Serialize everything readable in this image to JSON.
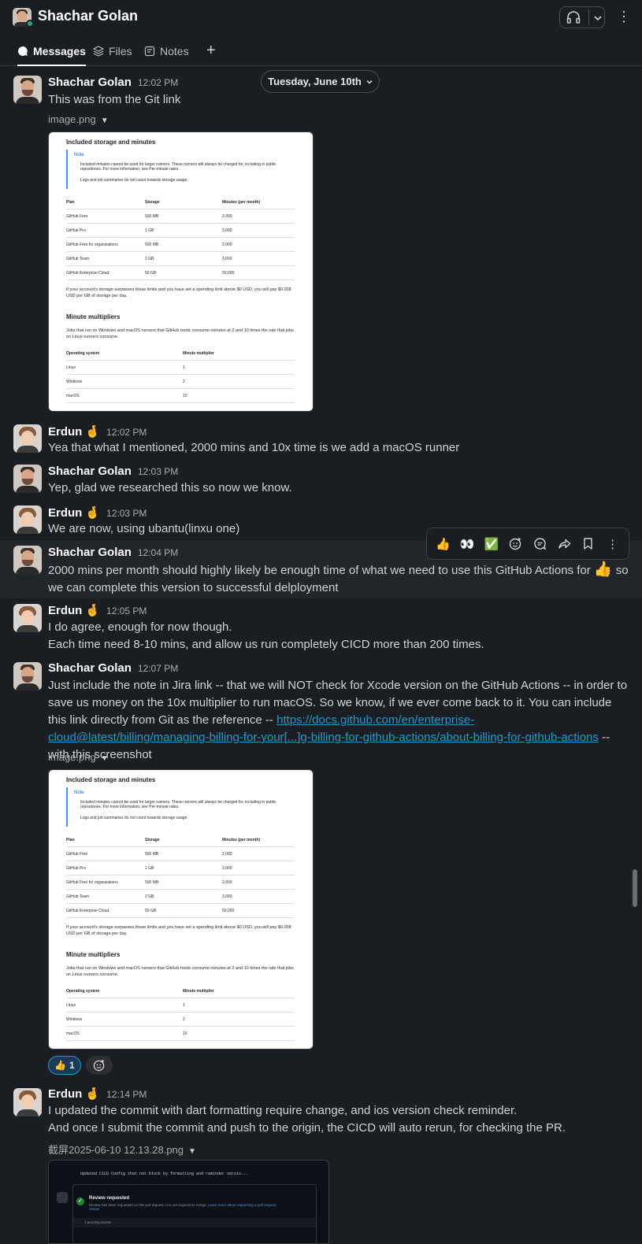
{
  "header": {
    "title": "Shachar Golan",
    "tabs": [
      {
        "label": "Messages"
      },
      {
        "label": "Files"
      },
      {
        "label": "Notes"
      }
    ],
    "add_tab": "+"
  },
  "date_divider": "Tuesday, June 10th",
  "messages": [
    {
      "author": "Shachar Golan",
      "time": "12:02 PM",
      "text": "This was from the Git link",
      "file": "image.png"
    },
    {
      "author": "Erdun",
      "status": "🤞",
      "time": "12:02 PM",
      "text": "Yea that what I mentioned, 2000 mins and 10x time is we add a macOS runner"
    },
    {
      "author": "Shachar Golan",
      "time": "12:03 PM",
      "text": "Yep, glad we researched this so now we know."
    },
    {
      "author": "Erdun",
      "status": "🤞",
      "time": "12:03 PM",
      "text": "We are now, using ubantu(linxu one)"
    },
    {
      "author": "Shachar Golan",
      "time": "12:04 PM",
      "text_a": "2000 mins per month should highly likely be enough time of what we need to use this GitHub Actions for",
      "emoji": "👍",
      "text_b": "so we can complete this version to successful delployment"
    },
    {
      "author": "Erdun",
      "status": "🤞",
      "time": "12:05 PM",
      "line1": "I do agree, enough for now though.",
      "line2": "Each time need 8-10 mins, and allow us run completely CICD more than 200 times."
    },
    {
      "author": "Shachar Golan",
      "time": "12:07 PM",
      "text_pre": "Just include the note in Jira link -- that we will NOT check for Xcode version on the GitHub Actions -- in order to save us money on the 10x multiplier to run macOS. So we know, if we ever come back to it. You can include this link directly from Git as the reference --",
      "link": "https://docs.github.com/en/enterprise-cloud@latest/billing/managing-billing-for-your[...]g-billing-for-github-actions/about-billing-for-github-actions",
      "text_post": "-- with this screenshot",
      "file": "image.png",
      "reaction_emoji": "👍",
      "reaction_count": "1"
    },
    {
      "author": "Erdun",
      "status": "🤞",
      "time": "12:14 PM",
      "line1": "I updated the commit with dart formatting require change, and ios version check reminder.",
      "line2": "And once I submit the commit and push to the origin, the CICD will auto rerun, for checking the PR.",
      "file": "截屏2025-06-10 12.13.28.png"
    }
  ],
  "screenshot": {
    "heading1": "Included storage and minutes",
    "note_title": "Note",
    "note_item1": "Included minutes cannot be used for larger runners. These runners will always be charged for, including in public repositories. For more information, see Per-minute rates.",
    "note_item2": "Logs and job summaries do not count towards storage usage.",
    "cols": [
      "Plan",
      "Storage",
      "Minutes (per month)"
    ],
    "rows": [
      [
        "GitHub Free",
        "500 MB",
        "2,000"
      ],
      [
        "GitHub Pro",
        "1 GB",
        "3,000"
      ],
      [
        "GitHub Free for organizations",
        "500 MB",
        "2,000"
      ],
      [
        "GitHub Team",
        "2 GB",
        "3,000"
      ],
      [
        "GitHub Enterprise Cloud",
        "50 GB",
        "50,000"
      ]
    ],
    "para": "If your account's storage surpasses these limits and you have set a spending limit above $0 USD, you will pay $0.008 USD per GB of storage per day.",
    "heading2": "Minute multipliers",
    "para2": "Jobs that run on Windows and macOS runners that GitHub hosts consume minutes at 2 and 10 times the rate that jobs on Linux runners consume.",
    "cols2": [
      "Operating system",
      "Minute multiplier"
    ],
    "rows2": [
      [
        "Linux",
        "1"
      ],
      [
        "Windows",
        "2"
      ],
      [
        "macOS",
        "10"
      ]
    ]
  },
  "dark_screenshot": {
    "commit": "Updated CICD Config that not block by formatting and reminder versio...",
    "review_title": "Review requested",
    "review_text": "Review has been requested on this pull request. It is not required to merge.",
    "review_link": "Learn more about requesting a pull request review.",
    "reviewer": "1 pending review"
  },
  "toolbar": [
    "👍",
    "👀",
    "✅",
    "add-reaction",
    "reply-in-thread",
    "forward",
    "save",
    "more"
  ],
  "colors": {
    "accent": "#1d9bd1",
    "background": "#1a1d21",
    "presence": "#2bac76"
  }
}
